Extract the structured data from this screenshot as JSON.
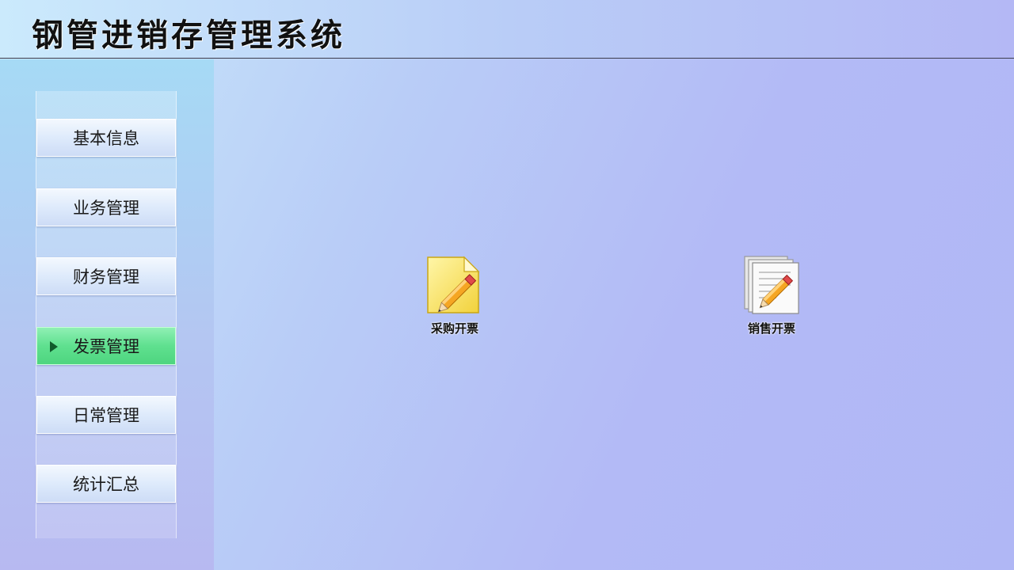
{
  "header": {
    "title": "钢管进销存管理系统"
  },
  "sidebar": {
    "items": [
      {
        "label": "基本信息",
        "active": false
      },
      {
        "label": "业务管理",
        "active": false
      },
      {
        "label": "财务管理",
        "active": false
      },
      {
        "label": "发票管理",
        "active": true
      },
      {
        "label": "日常管理",
        "active": false
      },
      {
        "label": "统计汇总",
        "active": false
      }
    ]
  },
  "main": {
    "shortcuts": [
      {
        "label": "采购开票",
        "icon": "notepad-pencil-icon"
      },
      {
        "label": "销售开票",
        "icon": "documents-pencil-icon"
      }
    ]
  },
  "colors": {
    "active_nav": "#5fe08f",
    "background": "#b3baf6"
  }
}
